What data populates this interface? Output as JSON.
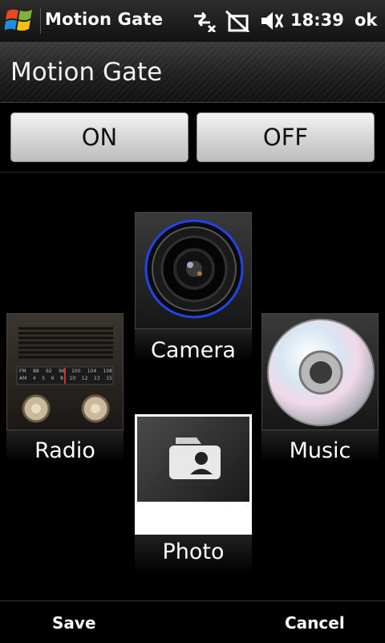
{
  "status_bar": {
    "app_title": "Motion Gate",
    "time": "18:39",
    "ok_label": "ok",
    "icons": [
      "windows-start-icon",
      "connectivity-arrows-icon",
      "no-sim-icon",
      "speaker-muted-icon"
    ]
  },
  "header": {
    "title": "Motion Gate"
  },
  "toggle": {
    "on_label": "ON",
    "off_label": "OFF"
  },
  "tiles": {
    "camera": {
      "label": "Camera",
      "icon": "camera-lens-icon"
    },
    "radio": {
      "label": "Radio",
      "icon": "radio-icon"
    },
    "music": {
      "label": "Music",
      "icon": "cd-disc-icon"
    },
    "photo": {
      "label": "Photo",
      "icon": "photo-contact-icon",
      "selected": true
    }
  },
  "softkeys": {
    "left": "Save",
    "right": "Cancel"
  },
  "colors": {
    "accent_ring": "#2244ee",
    "selection": "#ffffff",
    "background": "#000000"
  },
  "radio_dial": {
    "row1": [
      "FM",
      "88",
      "92",
      "96",
      "100",
      "104",
      "108"
    ],
    "row2": [
      "AM",
      "4",
      "5",
      "6",
      "8",
      "10",
      "12",
      "13",
      "15"
    ]
  }
}
